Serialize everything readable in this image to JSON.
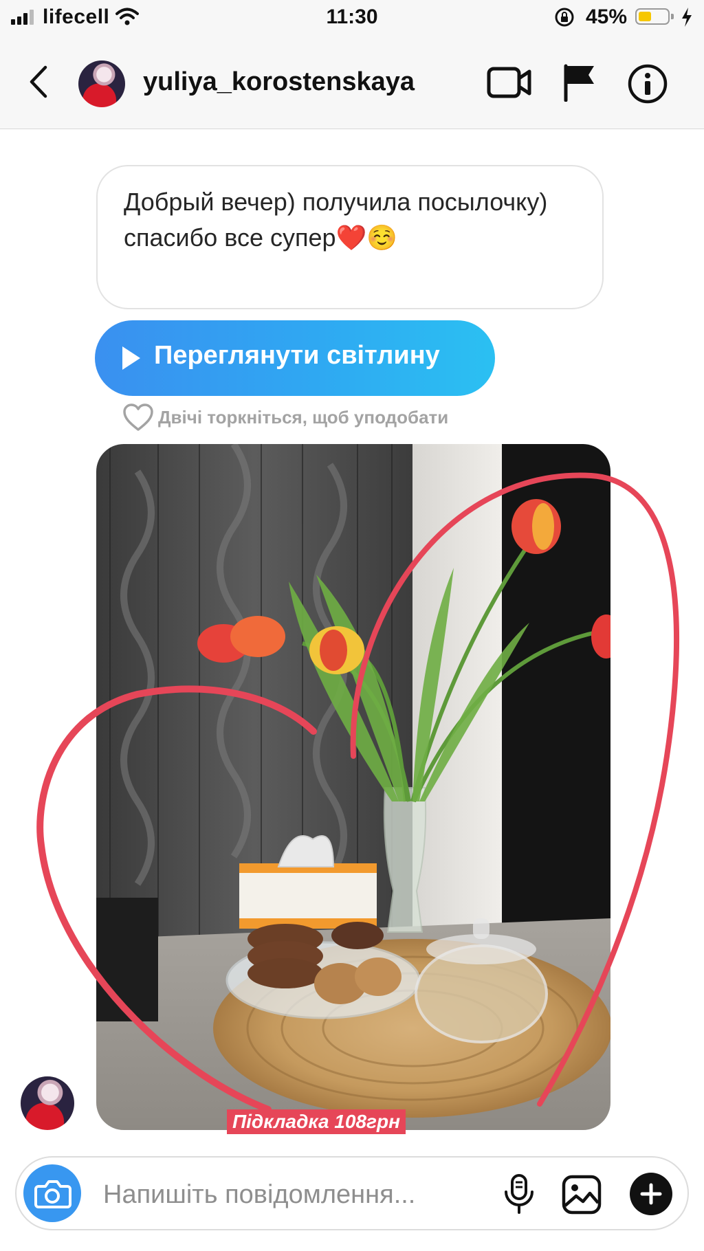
{
  "status_bar": {
    "carrier": "lifecell",
    "time": "11:30",
    "battery_percent": "45%",
    "battery_level": 0.45,
    "battery_color": "#f6c700"
  },
  "header": {
    "username": "yuliya_korostenskaya",
    "icons": [
      "back-chevron-icon",
      "avatar",
      "video-camera-icon",
      "flag-icon",
      "info-icon"
    ]
  },
  "messages": {
    "text": "Добрый вечер) получила посылочку) спасибо все супер❤️☺️",
    "view_photo_label": "Переглянути світлину",
    "like_hint": "Двічі торкніться, щоб уподобати",
    "photo_caption": "Підкладка 108грн"
  },
  "composer": {
    "placeholder": "Напишіть повідомлення...",
    "accent_color": "#3897f0"
  },
  "colors": {
    "header_bg": "#f7f7f7",
    "button_gradient_start": "#3a90f0",
    "button_gradient_end": "#2bc0f2",
    "heart_stroke": "#e64658"
  }
}
